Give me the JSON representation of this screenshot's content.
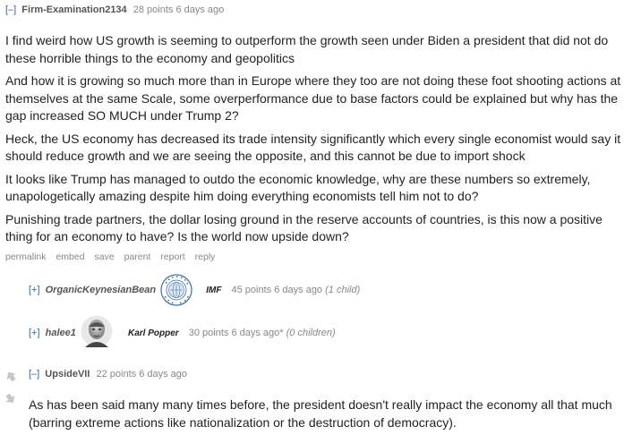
{
  "comment1": {
    "toggle": "[–]",
    "author": "Firm-Examination2134",
    "points": "28 points",
    "time": "6 days ago",
    "paragraphs": [
      "I find weird how US growth is seeming to outperform the growth seen under Biden a president that did not do these horrible things to the economy and geopolitics",
      "And how it is growing so much more than in Europe where they too are not doing these foot shooting actions at themselves at the same Scale, some overperformance due to base factors could be explained but why has the gap increased SO MUCH under Trump 2?",
      "Heck, the US economy has decreased its trade intensity significantly which every single economist would say it should reduce growth and we are seeing the opposite, and this cannot be due to import shock",
      "It looks like Trump has managed to outdo the economic knowledge, why are these numbers so extremely, unapologetically amazing despite him doing everything economists tell him not to do?",
      "Punishing trade partners, the dollar losing ground in the reserve accounts of countries, is this now a positive thing for an economy to have? Is the world now upside down?"
    ],
    "buttons": [
      "permalink",
      "embed",
      "save",
      "parent",
      "report",
      "reply"
    ]
  },
  "child1": {
    "toggle": "[+]",
    "author": "OrganicKeynesianBean",
    "flair_icon": "imf-seal-icon",
    "flair": "IMF",
    "points": "45 points",
    "time": "6 days ago",
    "children": "(1 child)"
  },
  "child2": {
    "toggle": "[+]",
    "author": "halee1",
    "flair_icon": "karl-popper-portrait-icon",
    "flair": "Karl Popper",
    "points": "30 points",
    "time": "6 days ago*",
    "children": "(0 children)"
  },
  "comment2": {
    "toggle": "[–]",
    "author": "UpsideVII",
    "points": "22 points",
    "time": "6 days ago",
    "body": "As has been said many many times before, the president doesn't really impact the economy all that much (barring extreme actions like nationalization or the destruction of democracy)."
  },
  "colors": {
    "link": "#336699",
    "meta": "#888888",
    "text": "#222222"
  }
}
